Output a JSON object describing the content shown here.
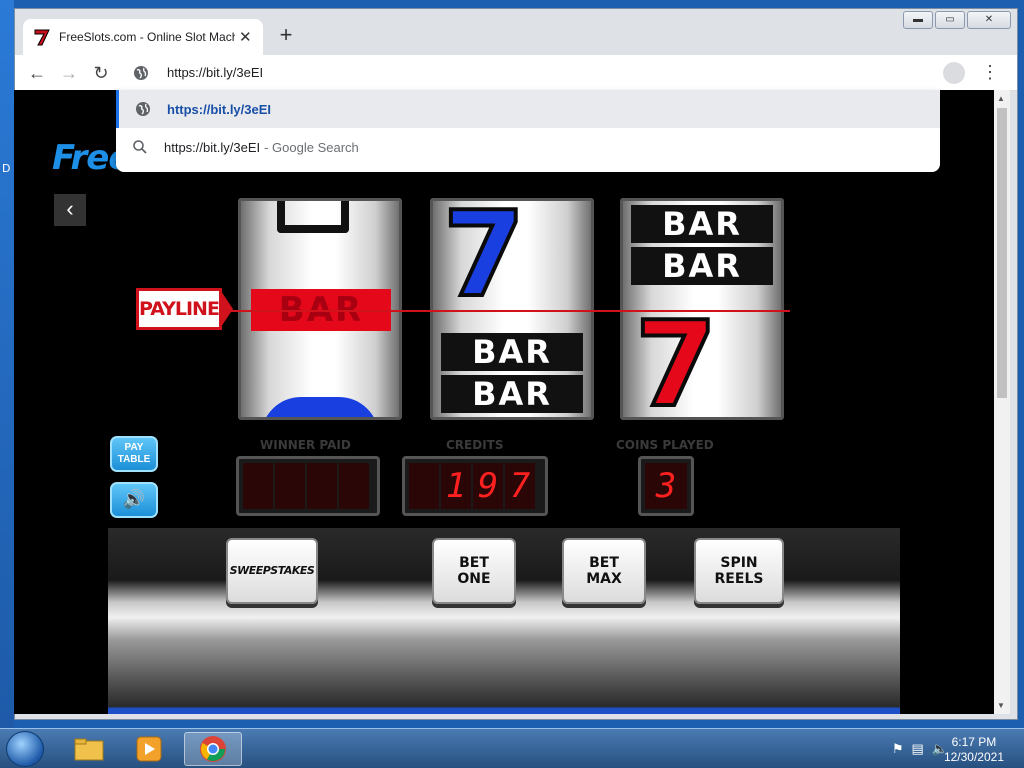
{
  "window": {
    "tab_title": "FreeSlots.com - Online Slot Mach",
    "tab_close": "✕",
    "new_tab": "+",
    "controls": {
      "minimize": "▬",
      "maximize": "▭",
      "close": "✕"
    }
  },
  "toolbar": {
    "back": "←",
    "forward": "→",
    "reload": "↻",
    "address_value": "https://bit.ly/3eEI",
    "menu": "⋮"
  },
  "suggestions": [
    {
      "icon": "globe-icon",
      "text": "https://bit.ly/3eEI",
      "sub": ""
    },
    {
      "icon": "search-icon",
      "text": "https://bit.ly/3eEI",
      "sub": "- Google Search"
    }
  ],
  "page": {
    "logo": "Free",
    "back_glyph": "‹",
    "payline": "PAYLINE",
    "reels": {
      "bar": "BAR",
      "seven": "7"
    },
    "side_buttons": {
      "pay_table_1": "PAY",
      "pay_table_2": "TABLE",
      "sound": "🔊"
    },
    "labels": {
      "winner_paid": "WINNER PAID",
      "credits": "CREDITS",
      "coins_played": "COINS PLAYED"
    },
    "credits_digits": [
      "1",
      "9",
      "7"
    ],
    "coins_played": "3",
    "buttons": {
      "sweepstakes": "SWEEPSTAKES",
      "bet_one_1": "BET",
      "bet_one_2": "ONE",
      "bet_max_1": "BET",
      "bet_max_2": "MAX",
      "spin_1": "SPIN",
      "spin_2": "REELS"
    }
  },
  "desktop": {
    "edge_char": "D"
  },
  "taskbar": {
    "time": "6:17 PM",
    "date": "12/30/2021"
  },
  "colors": {
    "payline_red": "#d0121c",
    "seven_blue": "#1a3fe0",
    "seven_red": "#e4081a",
    "led_red": "#ff2020",
    "logo_blue": "#1d8fe6"
  }
}
